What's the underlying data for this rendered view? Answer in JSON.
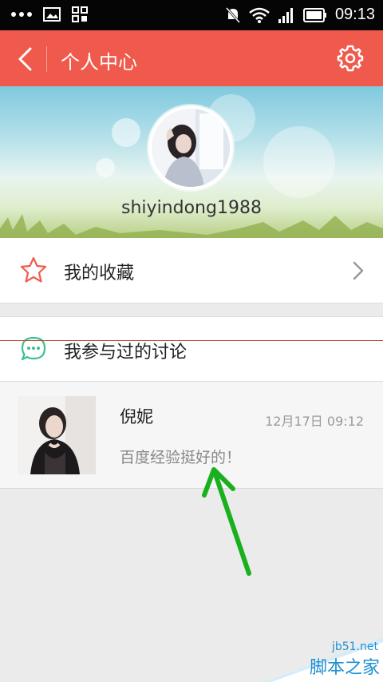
{
  "status_bar": {
    "time": "09:13",
    "icons": [
      "more-dots-icon",
      "image-icon",
      "grid-app-icon",
      "mute-icon",
      "wifi-icon",
      "signal-icon",
      "battery-icon"
    ]
  },
  "app_bar": {
    "title": "个人中心",
    "back_icon": "back-chevron-icon",
    "settings_icon": "gear-icon",
    "background_color": "#f05a4c"
  },
  "profile": {
    "username": "shiyindong1988"
  },
  "menu": {
    "favorites_label": "我的收藏",
    "discussions_label": "我参与过的讨论",
    "favorites_icon": "star-outline-icon",
    "discussions_icon": "chat-bubble-icon"
  },
  "post": {
    "author": "倪妮",
    "timestamp": "12月17日 09:12",
    "message": "百度经验挺好的！"
  },
  "watermark": {
    "url": "jb51.net",
    "name": "脚本之家"
  },
  "colors": {
    "accent": "#f05a4c",
    "discussion_icon": "#3cbf8f",
    "annotation_arrow": "#19b01f",
    "watermark": "#1f8fd1"
  }
}
